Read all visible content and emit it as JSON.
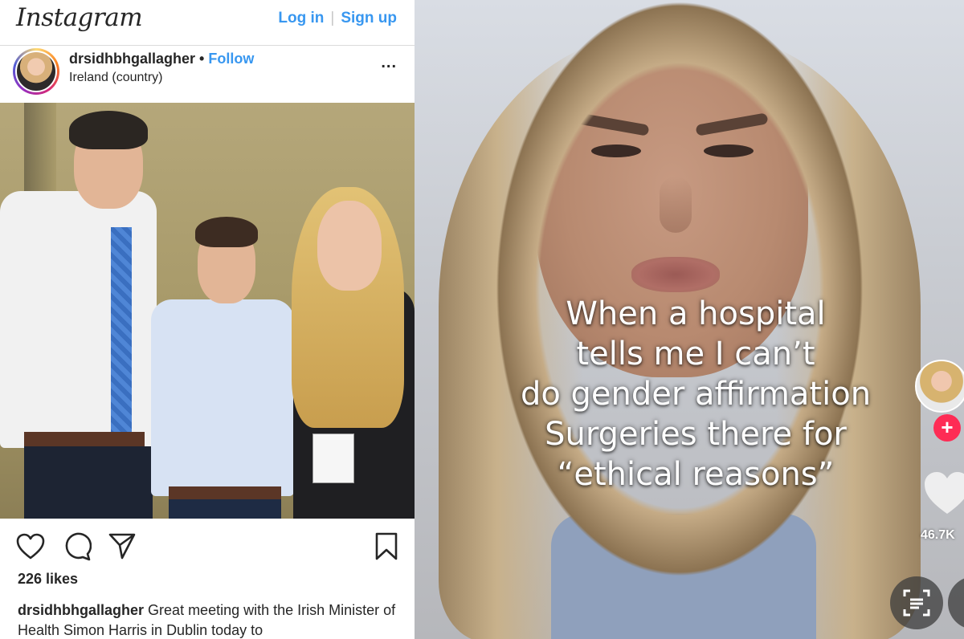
{
  "instagram": {
    "logo": "Instagram",
    "login_label": "Log in",
    "separator": "|",
    "signup_label": "Sign up",
    "username": "drsidhbhgallagher",
    "dot": "•",
    "follow_label": "Follow",
    "location": "Ireland (country)",
    "more_label": "...",
    "likes": "226 likes",
    "caption_user": "drsidhbhgallagher",
    "caption_text": "Great meeting with the Irish Minister of Health Simon Harris in Dublin today to",
    "accent_color": "#3897f0"
  },
  "tiktok": {
    "overlay_lines": [
      "When a hospital",
      "tells me I can’t",
      "do gender affirmation",
      "Surgeries there for",
      "“ethical reasons”"
    ],
    "plus_label": "+",
    "like_count": "46.7K",
    "icons": [
      "heart-icon",
      "scan-text-icon"
    ],
    "accent_color": "#fe2c55"
  }
}
